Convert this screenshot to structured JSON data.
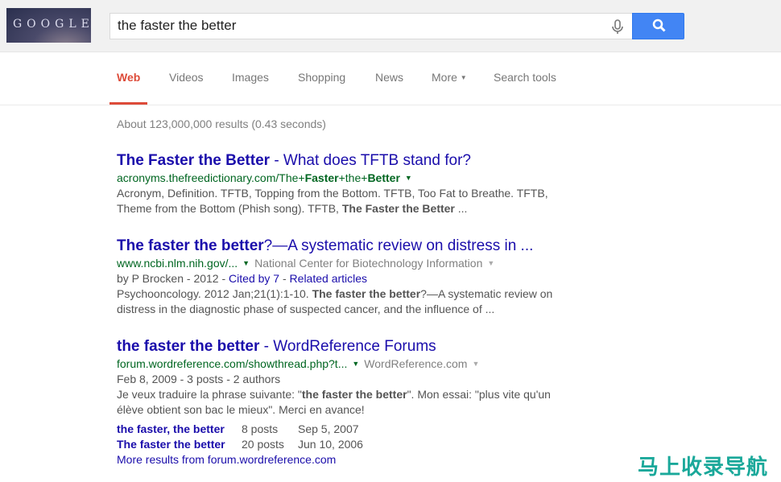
{
  "header": {
    "logo_text": "GOOGLE",
    "search_value": "the faster the better"
  },
  "tabs": [
    {
      "label": "Web",
      "active": true
    },
    {
      "label": "Videos"
    },
    {
      "label": "Images"
    },
    {
      "label": "Shopping"
    },
    {
      "label": "News"
    },
    {
      "label": "More"
    },
    {
      "label": "Search tools"
    }
  ],
  "stats": "About 123,000,000 results (0.43 seconds)",
  "results": [
    {
      "title_bold": "The Faster the Better",
      "title_rest": " - What does TFTB stand for?",
      "url_pre": "acronyms.thefreedictionary.com/The+",
      "url_b1": "Faster",
      "url_mid": "+the+",
      "url_b2": "Better",
      "snippet1": "Acronym, Definition. TFTB, Topping from the Bottom. TFTB, Too Fat to Breathe. TFTB,",
      "snippet2_pre": "Theme from the Bottom (Phish song). TFTB, ",
      "snippet2_bold": "The Faster the Better",
      "snippet2_post": " ..."
    },
    {
      "title_bold": "The faster the better",
      "title_rest": "?—A systematic review on distress in ...",
      "url": "www.ncbi.nlm.nih.gov/...",
      "source": "National Center for Biotechnology Information",
      "meta_pre": "by P Brocken - 2012 - ",
      "cited": "Cited by 7",
      "sep": " - ",
      "related": "Related articles",
      "snippet1_pre": "Psychooncology. 2012 Jan;21(1):1-10. ",
      "snippet1_bold": "The faster the better",
      "snippet1_post": "?—A systematic review on",
      "snippet2": "distress in the diagnostic phase of suspected cancer, and the influence of ..."
    },
    {
      "title_bold": "the faster the better",
      "title_rest": " - WordReference Forums",
      "url": "forum.wordreference.com/showthread.php?t...",
      "source": "WordReference.com",
      "meta": "Feb 8, 2009 - 3 posts - 2 authors",
      "snippet1_pre": "Je veux traduire la phrase suivante: \"",
      "snippet1_bold": "the faster the better",
      "snippet1_post": "\". Mon essai: \"plus vite qu'un",
      "snippet2": "élève obtient son bac le mieux\". Merci en avance!",
      "sublinks": [
        {
          "title": "the faster, the better",
          "posts": "8 posts",
          "date": "Sep 5, 2007"
        },
        {
          "title": "The faster the better",
          "posts": "20 posts",
          "date": "Jun 10, 2006"
        }
      ],
      "more": "More results from forum.wordreference.com"
    }
  ],
  "watermark": "马上收录导航",
  "colors": {
    "accent": "#dd4b39",
    "link": "#1a0dab",
    "url": "#006621",
    "button": "#4285f4"
  }
}
